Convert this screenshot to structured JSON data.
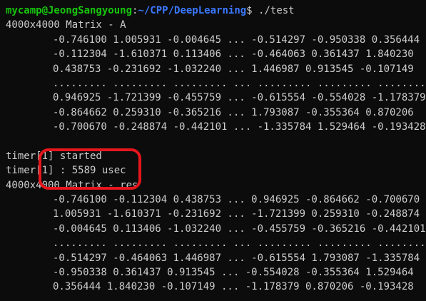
{
  "prompt": {
    "user_host": "mycamp@JeongSangyoung",
    "separator": ":",
    "path": "~/CPP/DeepLearning",
    "symbol": "$",
    "command": " ./test"
  },
  "matrix_a": {
    "header": "4000x4000 Matrix - A",
    "rows": [
      "-0.746100 1.005931 -0.004645 ... -0.514297 -0.950338 0.356444",
      "-0.112304 -1.610371 0.113406 ... -0.464063 0.361437 1.840230",
      "0.438753 -0.231692 -1.032240 ... 1.446987 0.913545 -0.107149",
      "......... ......... ......... ... ......... ......... .........",
      "0.946925 -1.721399 -0.455759 ... -0.615554 -0.554028 -1.178379",
      "-0.864662 0.259310 -0.365216 ... 1.793087 -0.355364 0.870206",
      "-0.700670 -0.248874 -0.442101 ... -1.335784 1.529464 -0.193428"
    ]
  },
  "timer": {
    "started": "timer[1] started",
    "result": "timer[1] : 5589 usec"
  },
  "matrix_res": {
    "header": "4000x4000 Matrix - res",
    "rows": [
      "-0.746100 -0.112304 0.438753 ... 0.946925 -0.864662 -0.700670",
      "1.005931 -1.610371 -0.231692 ... -1.721399 0.259310 -0.248874",
      "-0.004645 0.113406 -1.032240 ... -0.455759 -0.365216 -0.442101",
      "......... ......... ......... ... ......... ......... .........",
      "-0.514297 -0.464063 1.446987 ... -0.615554 1.793087 -1.335784",
      "-0.950338 0.361437 0.913545 ... -0.554028 -0.355364 1.529464",
      "0.356444 1.840230 -0.107149 ... -1.178379 0.870206 -0.193428"
    ]
  },
  "colors": {
    "background": "#0c0c0c",
    "text": "#cccccc",
    "prompt_user": "#16c60c",
    "prompt_path": "#3b78ff",
    "annotation": "#e5161c"
  }
}
